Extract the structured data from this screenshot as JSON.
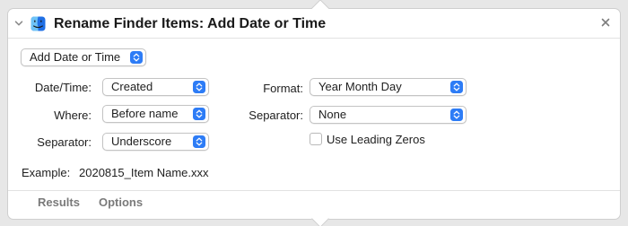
{
  "action": {
    "title": "Rename Finder Items: Add Date or Time",
    "mode_popup": "Add Date or Time"
  },
  "form": {
    "date_time_label": "Date/Time:",
    "date_time_value": "Created",
    "where_label": "Where:",
    "where_value": "Before name",
    "separator_left_label": "Separator:",
    "separator_left_value": "Underscore",
    "format_label": "Format:",
    "format_value": "Year Month Day",
    "separator_right_label": "Separator:",
    "separator_right_value": "None",
    "leading_zeros_label": "Use Leading Zeros",
    "leading_zeros_checked": false
  },
  "example": {
    "label": "Example:",
    "value": "2020815_Item Name.xxx"
  },
  "footer": {
    "results_tab": "Results",
    "options_tab": "Options"
  },
  "icons": {
    "disclosure": "chevron-down-icon",
    "app": "finder-icon",
    "close": "close-icon",
    "popup": "up-down-stepper-icon"
  },
  "colors": {
    "accent": "#2d7cf6",
    "finder_light": "#6ec3f7",
    "finder_dark": "#1f6fe5"
  }
}
